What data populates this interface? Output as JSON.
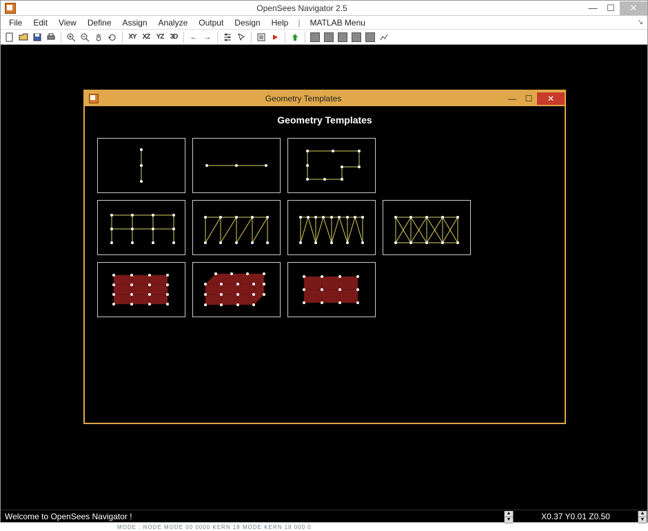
{
  "window": {
    "title": "OpenSees Navigator 2.5"
  },
  "menu": {
    "items": [
      "File",
      "Edit",
      "View",
      "Define",
      "Assign",
      "Analyze",
      "Output",
      "Design",
      "Help"
    ],
    "matlab": "MATLAB Menu"
  },
  "toolbar": {
    "groups": {
      "file": [
        "new",
        "open",
        "save",
        "print"
      ],
      "zoom": [
        "zoom-in",
        "zoom-out",
        "pan",
        "rotate"
      ],
      "views": [
        "XY",
        "XZ",
        "YZ",
        "3D"
      ],
      "nav": [
        "arrow-left",
        "arrow-right"
      ],
      "analysis": [
        "options",
        "select",
        "list",
        "run",
        "up"
      ],
      "squares": 5
    }
  },
  "dialog": {
    "title": "Geometry Templates",
    "heading": "Geometry Templates",
    "templates": [
      [
        "column",
        "beam",
        "g-frame"
      ],
      [
        "portal-frame",
        "truss-pratt",
        "truss-warren",
        "truss-x"
      ],
      [
        "solid-grid",
        "solid-3d",
        "shell-grid"
      ]
    ]
  },
  "status": {
    "message": "Welcome to OpenSees Navigator !",
    "coords": "X0.37 Y0.01 Z0.50"
  },
  "bottom_fragment": "MODE : NODE MODE   00   0000     KERN  18 MODE  KERN  18 000  0"
}
